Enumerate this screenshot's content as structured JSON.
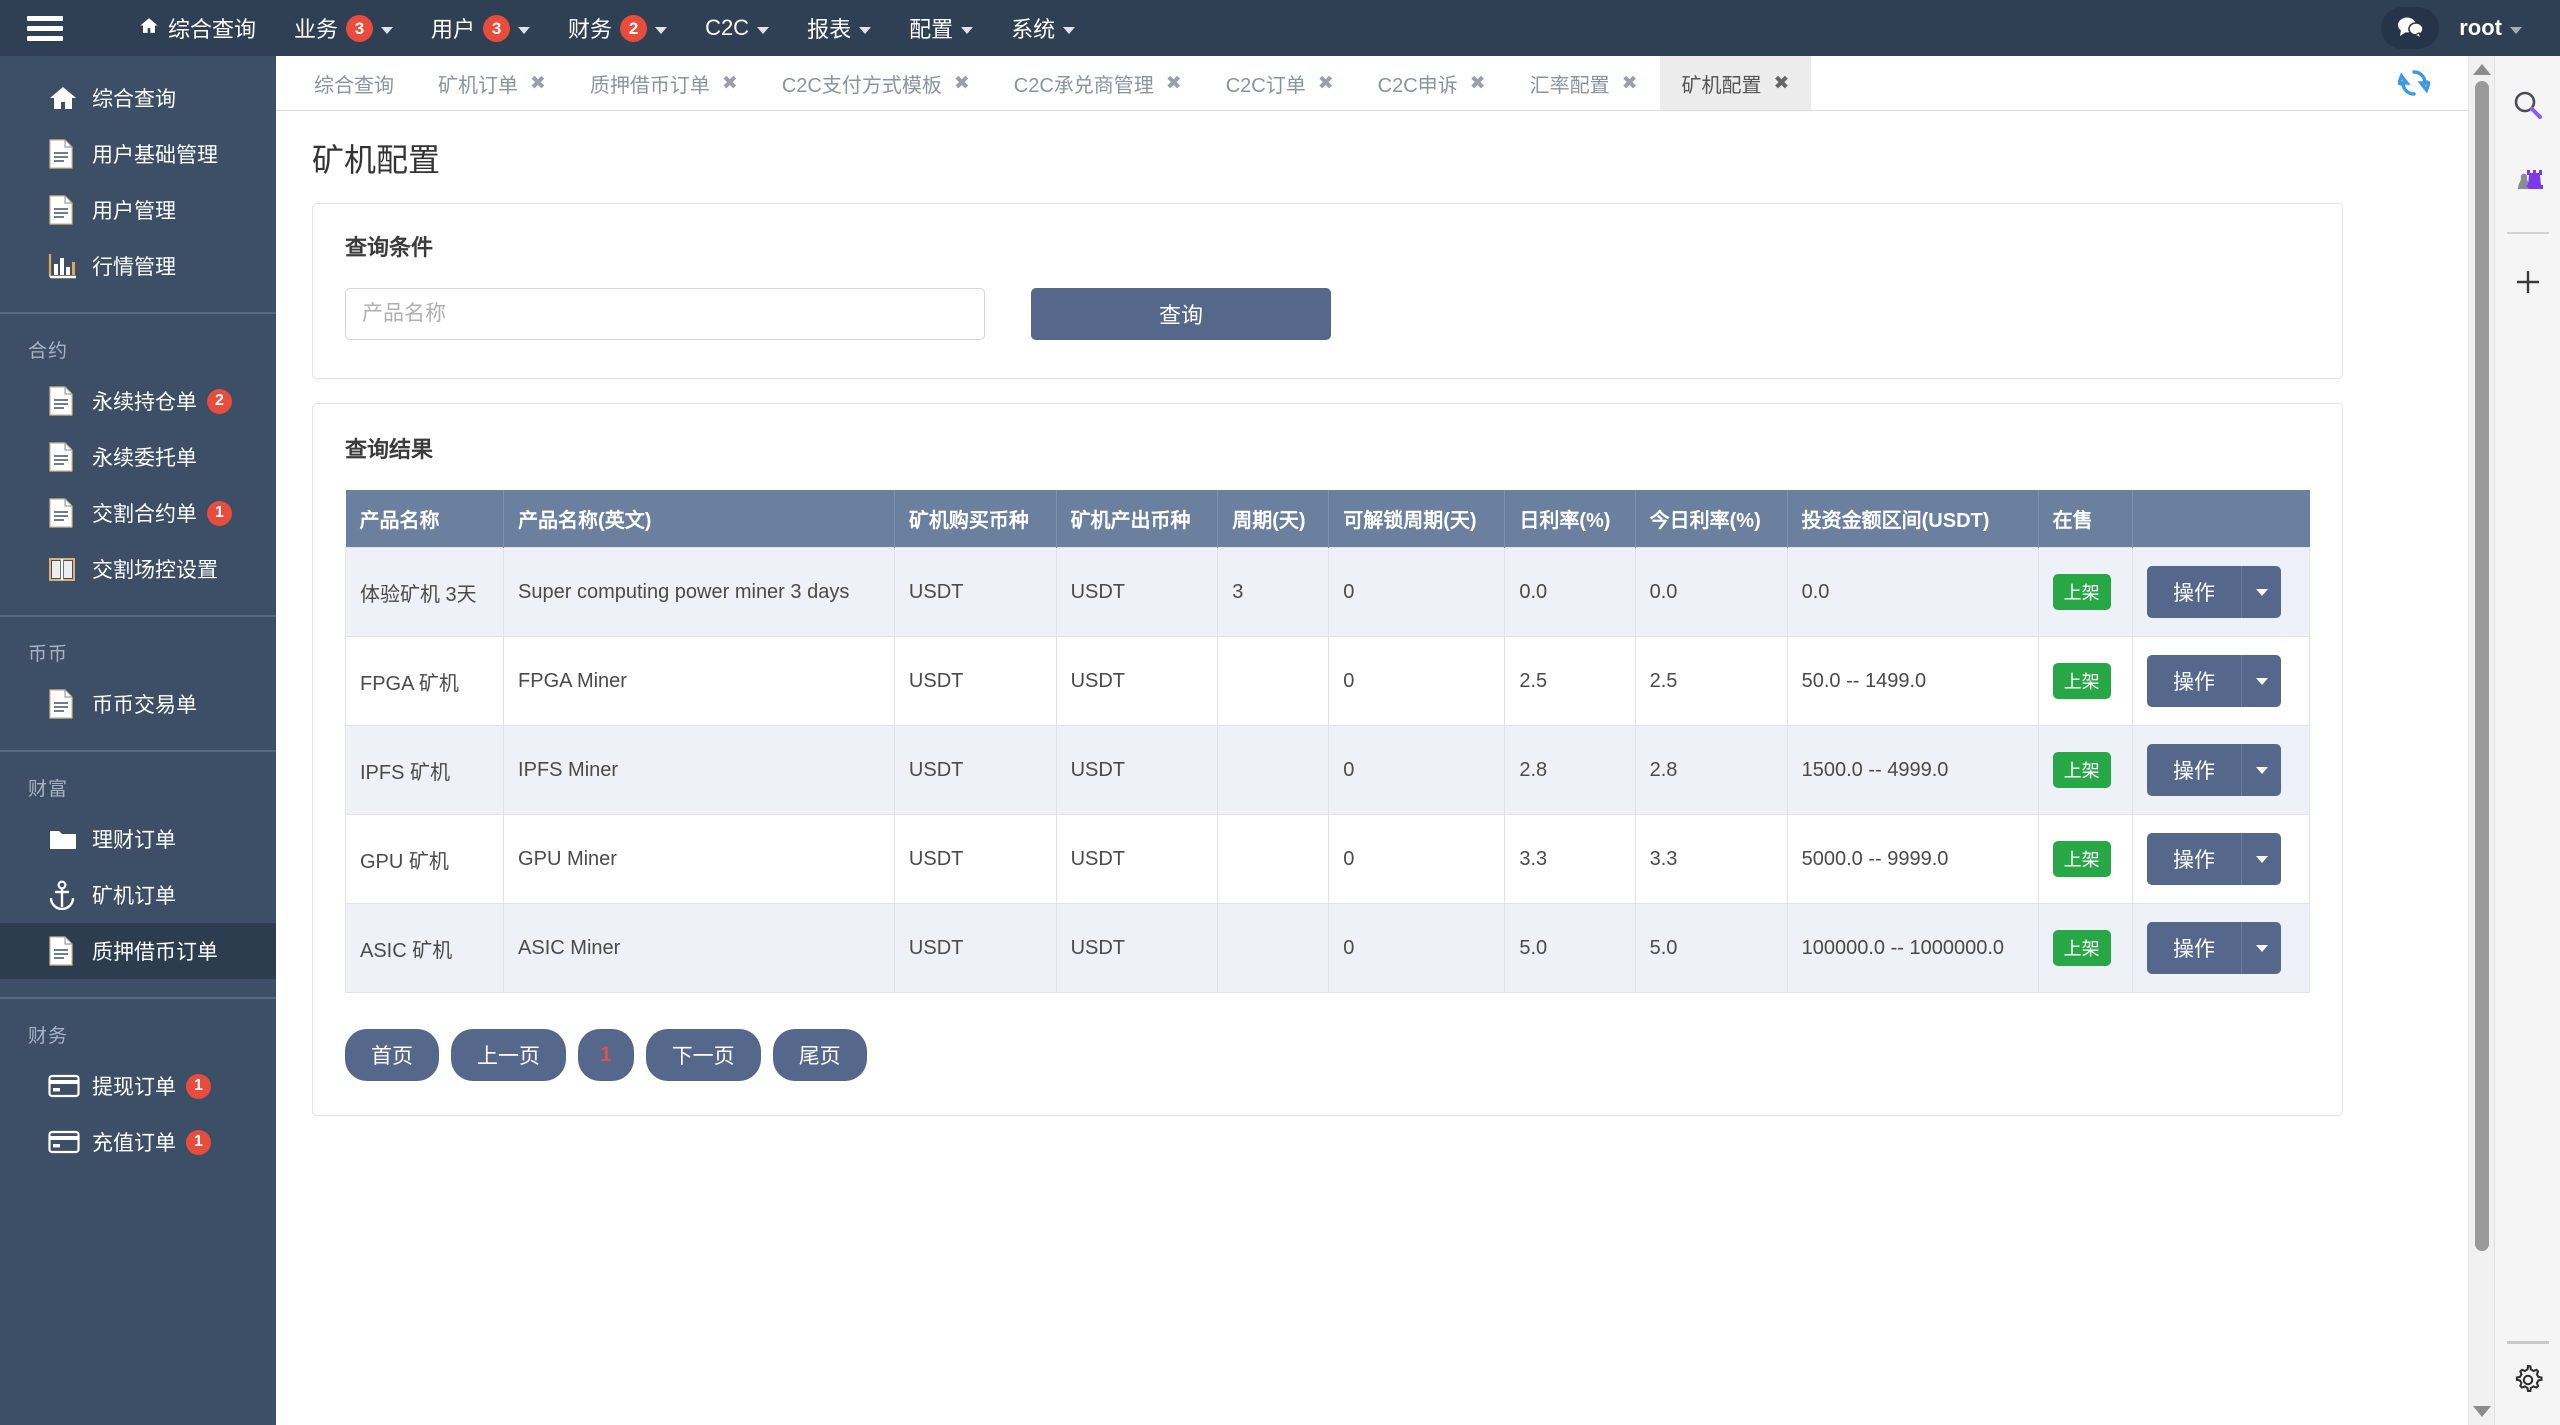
{
  "topbar": {
    "menu_icon": "hamburger-icon",
    "nav": [
      {
        "label": "综合查询",
        "icon": "home-icon",
        "badge": null,
        "caret": false
      },
      {
        "label": "业务",
        "icon": null,
        "badge": "3",
        "caret": true
      },
      {
        "label": "用户",
        "icon": null,
        "badge": "3",
        "caret": true
      },
      {
        "label": "财务",
        "icon": null,
        "badge": "2",
        "caret": true
      },
      {
        "label": "C2C",
        "icon": null,
        "badge": null,
        "caret": true
      },
      {
        "label": "报表",
        "icon": null,
        "badge": null,
        "caret": true
      },
      {
        "label": "配置",
        "icon": null,
        "badge": null,
        "caret": true
      },
      {
        "label": "系统",
        "icon": null,
        "badge": null,
        "caret": true
      }
    ],
    "chat_icon": "chat-bubbles-icon",
    "user": "root"
  },
  "sidebar": {
    "groups": [
      {
        "title": null,
        "items": [
          {
            "label": "综合查询",
            "icon": "home-icon",
            "badge": null,
            "active": false
          },
          {
            "label": "用户基础管理",
            "icon": "document-icon",
            "badge": null,
            "active": false
          },
          {
            "label": "用户管理",
            "icon": "document-icon",
            "badge": null,
            "active": false
          },
          {
            "label": "行情管理",
            "icon": "bar-chart-icon",
            "badge": null,
            "active": false
          }
        ]
      },
      {
        "title": "合约",
        "items": [
          {
            "label": "永续持仓单",
            "icon": "document-icon",
            "badge": "2",
            "active": false
          },
          {
            "label": "永续委托单",
            "icon": "document-icon",
            "badge": null,
            "active": false
          },
          {
            "label": "交割合约单",
            "icon": "document-icon",
            "badge": "1",
            "active": false
          },
          {
            "label": "交割场控设置",
            "icon": "columns-icon",
            "badge": null,
            "active": false
          }
        ]
      },
      {
        "title": "币币",
        "items": [
          {
            "label": "币币交易单",
            "icon": "document-icon",
            "badge": null,
            "active": false
          }
        ]
      },
      {
        "title": "财富",
        "items": [
          {
            "label": "理财订单",
            "icon": "folder-icon",
            "badge": null,
            "active": false
          },
          {
            "label": "矿机订单",
            "icon": "anchor-icon",
            "badge": null,
            "active": false
          },
          {
            "label": "质押借币订单",
            "icon": "document-icon",
            "badge": null,
            "active": true
          }
        ]
      },
      {
        "title": "财务",
        "items": [
          {
            "label": "提现订单",
            "icon": "credit-card-icon",
            "badge": "1",
            "active": false
          },
          {
            "label": "充值订单",
            "icon": "credit-card-icon",
            "badge": "1",
            "active": false
          }
        ]
      }
    ]
  },
  "tabs": [
    {
      "label": "综合查询",
      "closable": false,
      "active": false
    },
    {
      "label": "矿机订单",
      "closable": true,
      "active": false
    },
    {
      "label": "质押借币订单",
      "closable": true,
      "active": false
    },
    {
      "label": "C2C支付方式模板",
      "closable": true,
      "active": false
    },
    {
      "label": "C2C承兑商管理",
      "closable": true,
      "active": false
    },
    {
      "label": "C2C订单",
      "closable": true,
      "active": false
    },
    {
      "label": "C2C申诉",
      "closable": true,
      "active": false
    },
    {
      "label": "汇率配置",
      "closable": true,
      "active": false
    },
    {
      "label": "矿机配置",
      "closable": true,
      "active": true
    }
  ],
  "refresh_icon": "refresh-icon",
  "page": {
    "title": "矿机配置",
    "query_panel": {
      "heading": "查询条件",
      "input_placeholder": "产品名称",
      "input_value": "",
      "submit_label": "查询"
    },
    "results_panel": {
      "heading": "查询结果",
      "columns": [
        "产品名称",
        "产品名称(英文)",
        "矿机购买币种",
        "矿机产出币种",
        "周期(天)",
        "可解锁周期(天)",
        "日利率(%)",
        "今日利率(%)",
        "投资金额区间(USDT)",
        "在售",
        ""
      ],
      "rows": [
        {
          "name": "体验矿机 3天",
          "name_en": "Super computing power miner 3 days",
          "buy_coin": "USDT",
          "out_coin": "USDT",
          "period": "3",
          "unlock_period": "0",
          "daily_rate": "0.0",
          "today_rate": "0.0",
          "amount_range": "0.0",
          "status": "上架",
          "action_label": "操作"
        },
        {
          "name": "FPGA 矿机",
          "name_en": "FPGA Miner",
          "buy_coin": "USDT",
          "out_coin": "USDT",
          "period": "",
          "unlock_period": "0",
          "daily_rate": "2.5",
          "today_rate": "2.5",
          "amount_range": "50.0 -- 1499.0",
          "status": "上架",
          "action_label": "操作"
        },
        {
          "name": "IPFS 矿机",
          "name_en": "IPFS Miner",
          "buy_coin": "USDT",
          "out_coin": "USDT",
          "period": "",
          "unlock_period": "0",
          "daily_rate": "2.8",
          "today_rate": "2.8",
          "amount_range": "1500.0 -- 4999.0",
          "status": "上架",
          "action_label": "操作"
        },
        {
          "name": "GPU 矿机",
          "name_en": "GPU Miner",
          "buy_coin": "USDT",
          "out_coin": "USDT",
          "period": "",
          "unlock_period": "0",
          "daily_rate": "3.3",
          "today_rate": "3.3",
          "amount_range": "5000.0 -- 9999.0",
          "status": "上架",
          "action_label": "操作"
        },
        {
          "name": "ASIC 矿机",
          "name_en": "ASIC Miner",
          "buy_coin": "USDT",
          "out_coin": "USDT",
          "period": "",
          "unlock_period": "0",
          "daily_rate": "5.0",
          "today_rate": "5.0",
          "amount_range": "100000.0 -- 1000000.0",
          "status": "上架",
          "action_label": "操作"
        }
      ],
      "pagination": [
        {
          "label": "首页",
          "current": false
        },
        {
          "label": "上一页",
          "current": false
        },
        {
          "label": "1",
          "current": true
        },
        {
          "label": "下一页",
          "current": false
        },
        {
          "label": "尾页",
          "current": false
        }
      ]
    }
  },
  "right_rail": {
    "icons": [
      "search-icon",
      "chess-pieces-icon",
      "plus-icon",
      "gear-icon"
    ]
  },
  "colors": {
    "topbar_bg": "#2f4054",
    "sidebar_bg": "#3c4f66",
    "sidebar_active": "#2d3d50",
    "accent_button": "#55678b",
    "table_header": "#6b7f9e",
    "badge_red": "#e74c3c",
    "status_green": "#27a745",
    "page_num_red": "#d9534f"
  }
}
